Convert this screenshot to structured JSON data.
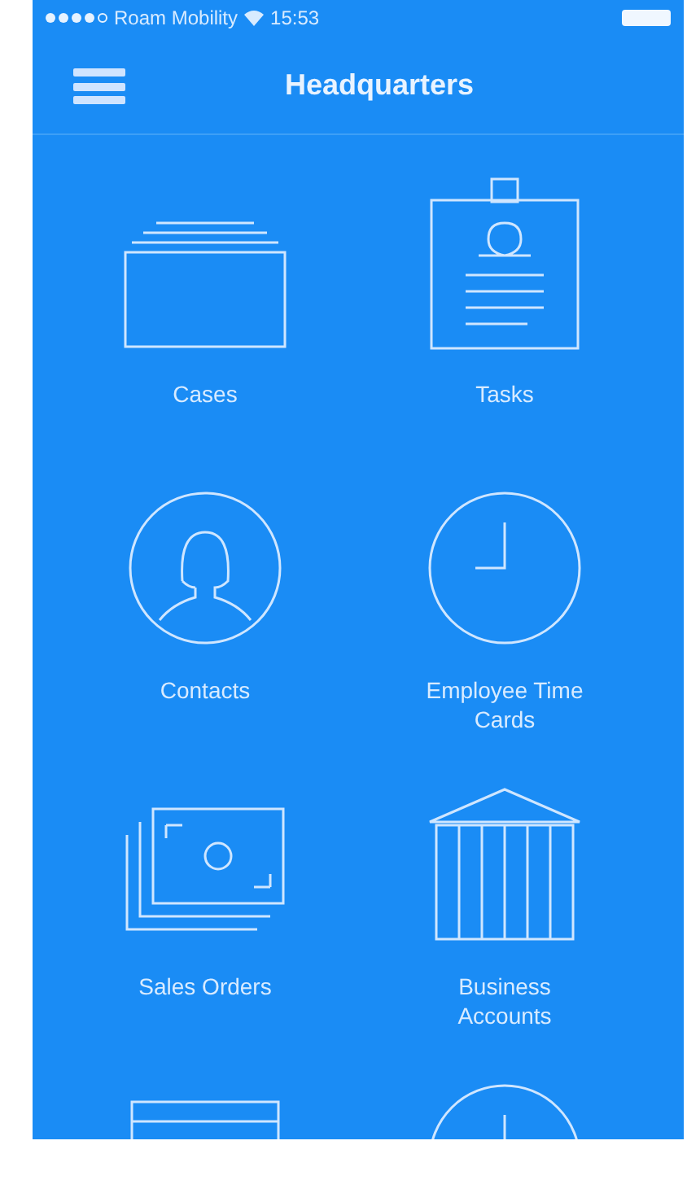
{
  "status_bar": {
    "carrier": "Roam Mobility",
    "time": "15:53"
  },
  "header": {
    "title": "Headquarters"
  },
  "tiles": [
    {
      "kind": "cases",
      "label": "Cases"
    },
    {
      "kind": "tasks",
      "label": "Tasks"
    },
    {
      "kind": "contacts",
      "label": "Contacts"
    },
    {
      "kind": "clock",
      "label": "Employee Time Cards"
    },
    {
      "kind": "bills",
      "label": "Sales Orders"
    },
    {
      "kind": "bank",
      "label": "Business Accounts"
    },
    {
      "kind": "cards"
    },
    {
      "kind": "clock"
    }
  ]
}
